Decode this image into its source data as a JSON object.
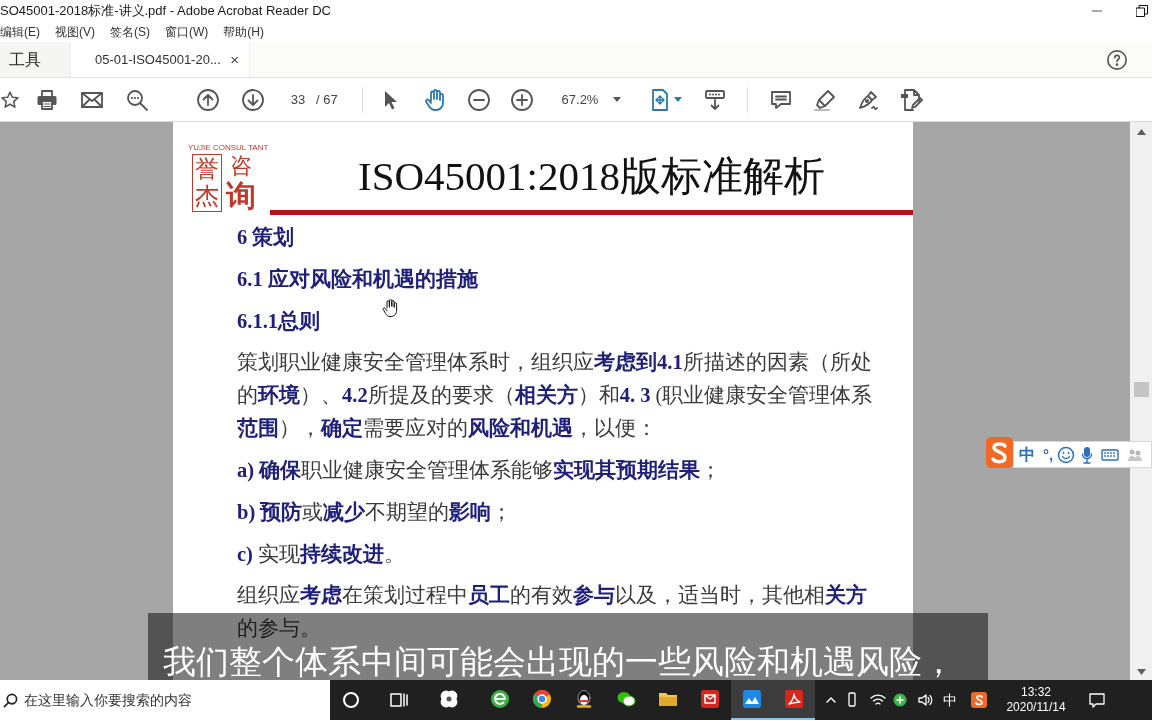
{
  "window": {
    "title": "SO45001-2018标准-讲义.pdf - Adobe Acrobat Reader DC"
  },
  "menu": [
    "编辑(E)",
    "视图(V)",
    "签名(S)",
    "窗口(W)",
    "帮助(H)"
  ],
  "tabs": [
    {
      "label": "工具",
      "selected": false
    },
    {
      "label": "05-01-ISO45001-20...",
      "selected": true,
      "close": "×"
    }
  ],
  "toolbar": {
    "page": "33",
    "page_count": "/ 67",
    "zoom": "67.2%",
    "tools": [
      {
        "selected": false
      },
      {
        "selected": true
      }
    ]
  },
  "document": {
    "logo": {
      "caption": "YUJIE CONSUL TANT",
      "chars": [
        "誉",
        "杰",
        "咨",
        "询"
      ]
    },
    "title": "ISO45001:2018版标准解析",
    "body": [
      {
        "kind": "heading",
        "text": "6 策划"
      },
      {
        "kind": "heading",
        "text": "6.1 应对风险和机遇的措施"
      },
      {
        "kind": "heading",
        "text": "6.1.1总则"
      },
      {
        "kind": "paragraph",
        "text": "策划职业健康安全管理体系时，组织应**考虑到4.1**所描述的因素（所处的**环境**）、**4.2**所提及的要求（**相关方**）和**4. 3** (职业健康安全管理体系**范围**），**确定**需要应对的**风险和机遇**，以便："
      },
      {
        "kind": "item",
        "text": "**a) 确保**职业健康安全管理体系能够**实现其预期结果**；"
      },
      {
        "kind": "item",
        "text": "**b) 预防**或**减少**不期望的**影响**；"
      },
      {
        "kind": "item",
        "text": "**c)** 实现**持续改进**。"
      },
      {
        "kind": "paragraph",
        "text": "组织应**考虑**在策划过程中**员工**的有效**参与**以及，适当时，其他相**关方**的参与。"
      }
    ]
  },
  "subtitle": "我们整个体系中间可能会出现的一些风险和机遇风险，",
  "ime": {
    "mode": "中",
    "punctuation": "°,"
  },
  "taskbar": {
    "search": {
      "placeholder": "在这里输入你要搜索的内容"
    },
    "apps": [
      {
        "active": false
      },
      {
        "active": false
      },
      {
        "active": false
      },
      {
        "active": false
      },
      {
        "active": false
      },
      {
        "active": false
      },
      {
        "active": false
      },
      {
        "active": true
      },
      {
        "active": true
      }
    ],
    "input_language": "中",
    "time": "13:32",
    "date": "2020/11/14"
  }
}
